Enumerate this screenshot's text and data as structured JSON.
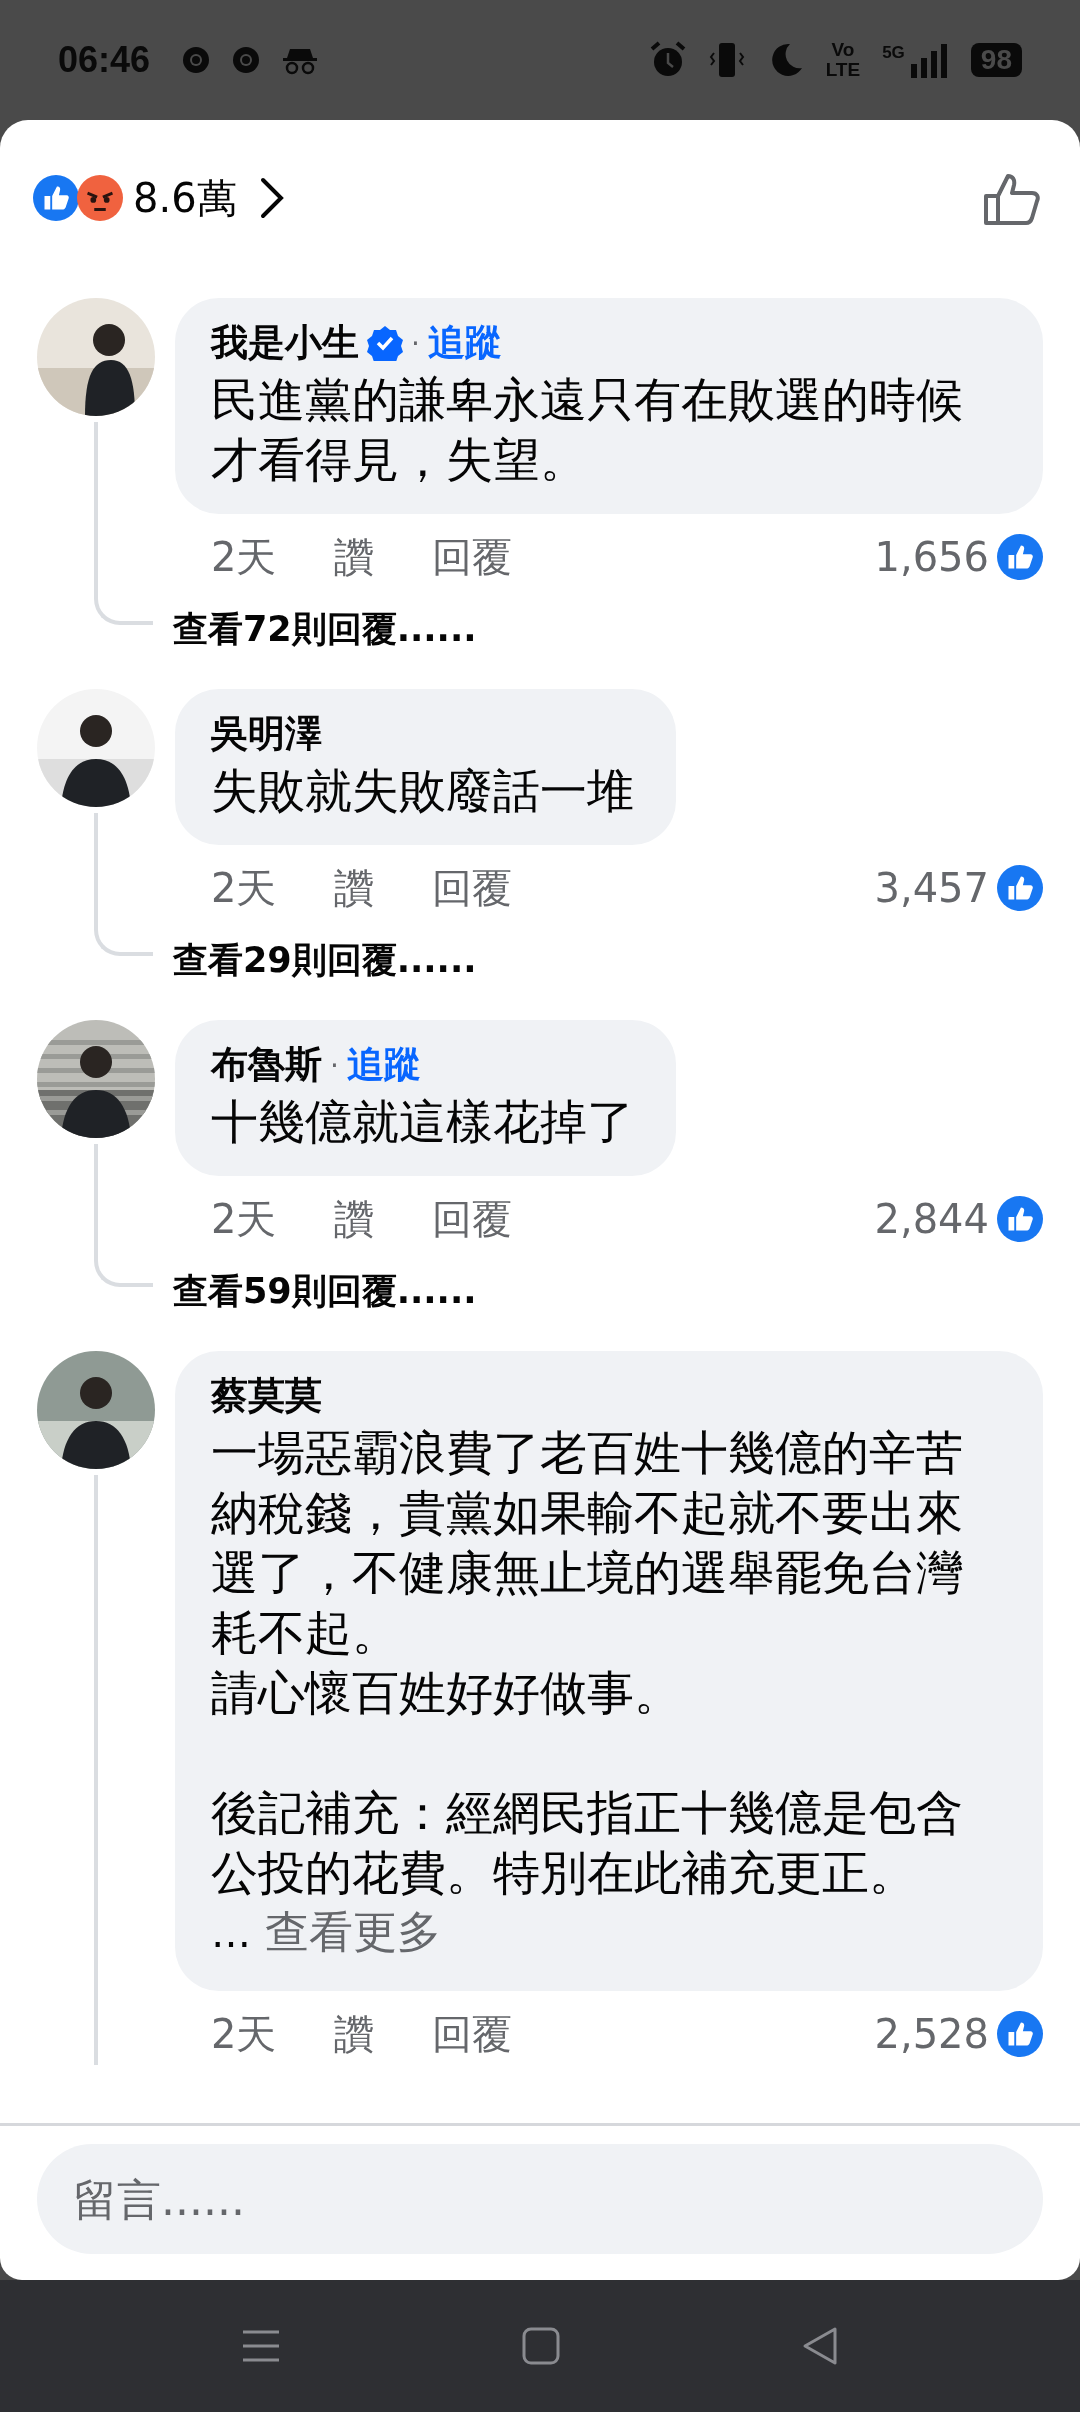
{
  "status_bar": {
    "time": "06:46",
    "volte_top": "Vo",
    "volte_bottom": "LTE",
    "network": "5G",
    "battery": "98"
  },
  "reactions": {
    "count": "8.6萬"
  },
  "comments": [
    {
      "author": "我是小生",
      "verified": true,
      "separator": "·",
      "follow": "追蹤",
      "text": "民進黨的謙卑永遠只有在敗選的時候才看得見，失望。",
      "time": "2天",
      "like": "讚",
      "reply": "回覆",
      "likes": "1,656",
      "replies_link": "查看72則回覆......"
    },
    {
      "author": "吳明澤",
      "verified": false,
      "text": "失敗就失敗廢話一堆",
      "time": "2天",
      "like": "讚",
      "reply": "回覆",
      "likes": "3,457",
      "replies_link": "查看29則回覆......"
    },
    {
      "author": "布魯斯",
      "verified": false,
      "separator": "·",
      "follow": "追蹤",
      "text": "十幾億就這樣花掉了",
      "time": "2天",
      "like": "讚",
      "reply": "回覆",
      "likes": "2,844",
      "replies_link": "查看59則回覆......"
    },
    {
      "author": "蔡莫莫",
      "verified": false,
      "text": "一場惡霸浪費了老百姓十幾億的辛苦納稅錢，貴黨如果輸不起就不要出來選了，不健康無止境的選舉罷免台灣耗不起。",
      "text_line_2": "請心懷百姓好好做事。",
      "postscript": "後記補充：經網民指正十幾億是包含公投的花費。特別在此補充更正。",
      "ellipsis": "…",
      "see_more": "查看更多",
      "time": "2天",
      "like": "讚",
      "reply": "回覆",
      "likes": "2,528"
    }
  ],
  "comment_box": {
    "placeholder": "留言......"
  }
}
